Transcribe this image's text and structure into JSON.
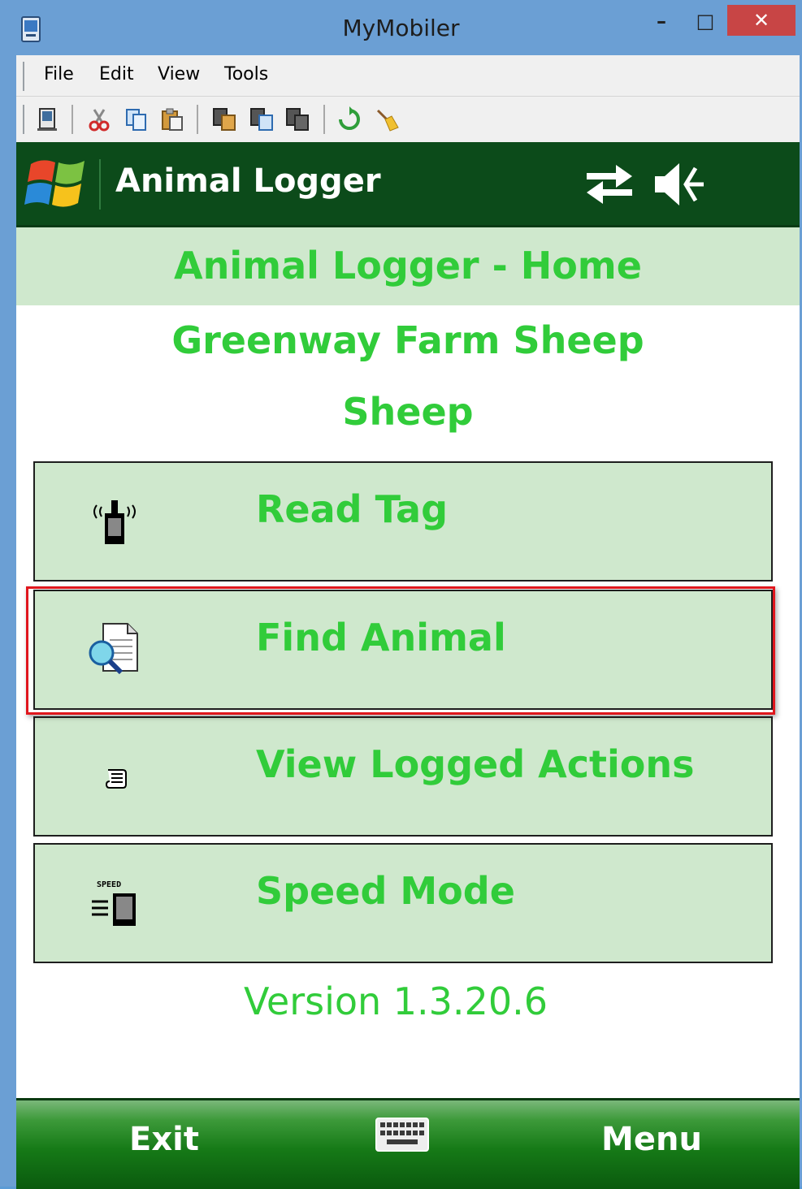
{
  "window": {
    "title": "MyMobiler",
    "minimize_glyph": "–",
    "maximize_glyph": "□",
    "close_glyph": "✕"
  },
  "menubar": {
    "items": [
      {
        "label": "File"
      },
      {
        "label": "Edit"
      },
      {
        "label": "View"
      },
      {
        "label": "Tools"
      }
    ]
  },
  "toolbar": {
    "buttons": [
      {
        "icon": "device-icon"
      },
      {
        "icon": "cut-icon"
      },
      {
        "icon": "copy-icon"
      },
      {
        "icon": "paste-icon"
      },
      {
        "icon": "copy-to-device-icon"
      },
      {
        "icon": "copy-from-device-icon"
      },
      {
        "icon": "screenshot-icon"
      },
      {
        "icon": "refresh-icon"
      },
      {
        "icon": "clean-icon"
      }
    ]
  },
  "device": {
    "header_title": "Animal Logger",
    "status_icons": [
      "connectivity-icon",
      "speaker-muted-icon"
    ]
  },
  "content": {
    "home_title": "Animal Logger - Home",
    "farm_name": "Greenway Farm Sheep",
    "species": "Sheep",
    "buttons": [
      {
        "label": "Read Tag",
        "icon": "rfid-reader-icon"
      },
      {
        "label": "Find Animal",
        "icon": "document-search-icon",
        "highlighted": true
      },
      {
        "label": "View Logged Actions",
        "icon": "scroll-icon"
      },
      {
        "label": "Speed Mode",
        "icon": "speed-mode-icon"
      }
    ],
    "version": "Version 1.3.20.6"
  },
  "softkeys": {
    "left": "Exit",
    "right": "Menu",
    "center_icon": "keyboard-icon"
  },
  "colors": {
    "accent_green": "#31cc3a",
    "button_bg": "#cfe8cd",
    "header_bg": "#0c4b1a",
    "highlight_border": "#e0161d"
  }
}
